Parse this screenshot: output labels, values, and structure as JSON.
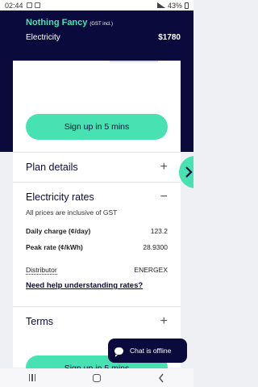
{
  "status_bar": {
    "time": "02:44",
    "battery": "43%"
  },
  "header": {
    "plan_name": "Nothing Fancy",
    "plan_note": "(GST incl.)",
    "fuel": "Electricity",
    "price": "$1780"
  },
  "signup_label": "Sign up in 5 mins",
  "sections": {
    "plan_details": {
      "title": "Plan details",
      "toggle": "+"
    },
    "electricity_rates": {
      "title": "Electricity rates",
      "toggle": "−",
      "note": "All prices are inclusive of GST",
      "rows": [
        {
          "label": "Daily charge (¢/day)",
          "value": "123.2"
        },
        {
          "label": "Peak rate (¢/kWh)",
          "value": "28.9300"
        }
      ],
      "distributor": {
        "label": "Distributor",
        "value": "ENERGEX"
      },
      "help_link": "Need help understanding rates?"
    },
    "terms": {
      "title": "Terms",
      "toggle": "+"
    }
  },
  "chat": {
    "label": "Chat is offline"
  },
  "colors": {
    "navy": "#0a0a3c",
    "accent": "#48e2b2"
  }
}
